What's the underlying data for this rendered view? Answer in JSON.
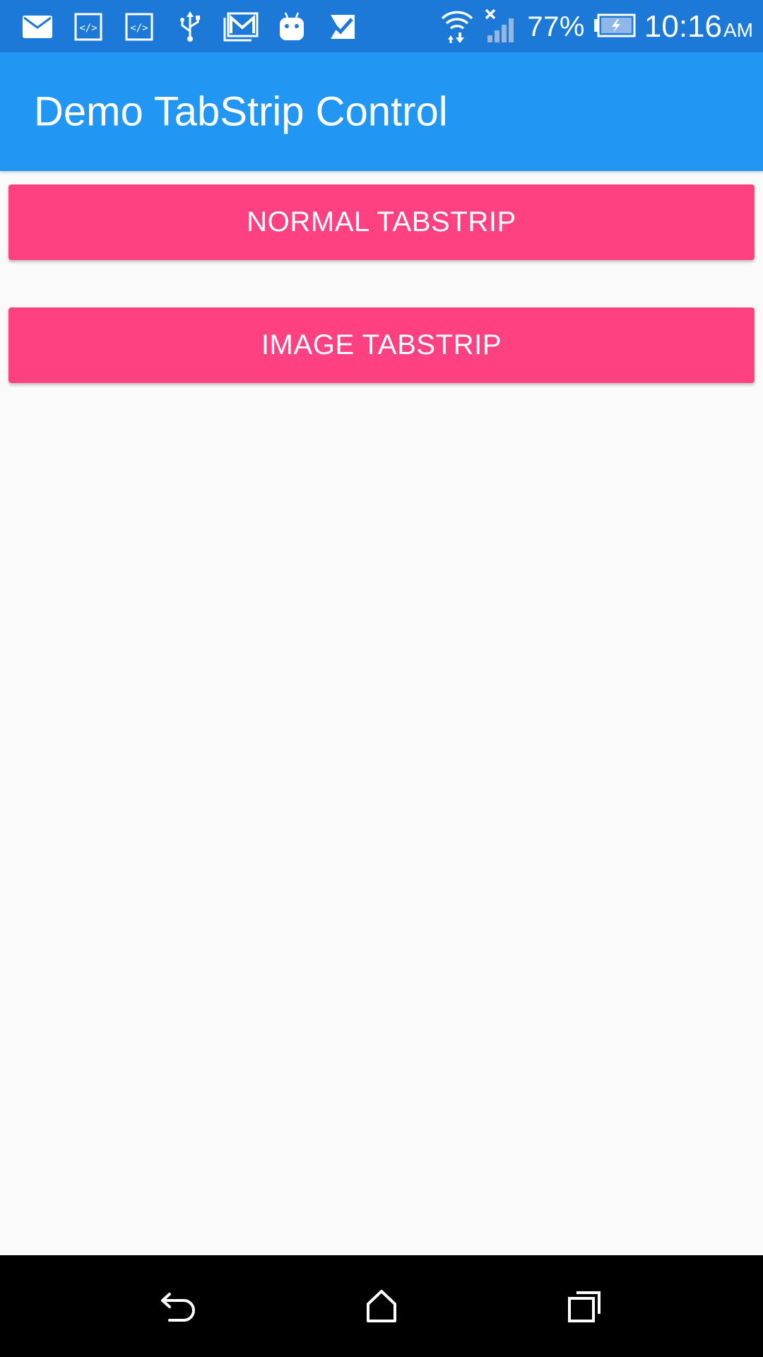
{
  "status_bar": {
    "left_icons": [
      "mail-icon",
      "code-icon",
      "code-icon",
      "usb-icon",
      "gmail-icon",
      "android-icon",
      "task-check-icon"
    ],
    "battery_percent": "77%",
    "time": "10:16",
    "ampm": "AM",
    "background_color": "#1c79d8"
  },
  "app_bar": {
    "title": "Demo TabStrip Control",
    "background_color": "#2196f3"
  },
  "buttons": {
    "normal_tabstrip": "NORMAL TABSTRIP",
    "image_tabstrip": "IMAGE TABSTRIP",
    "accent_color": "#ff4081"
  },
  "nav_bar": {
    "items": [
      "back-icon",
      "home-icon",
      "recents-icon"
    ]
  }
}
